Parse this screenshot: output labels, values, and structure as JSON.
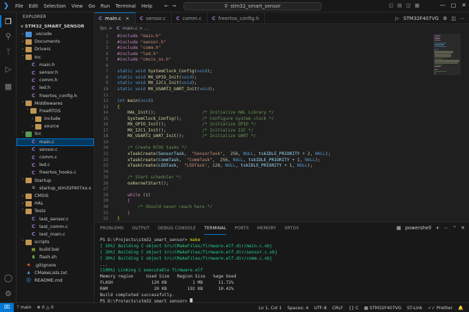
{
  "titlebar": {
    "menu": [
      "File",
      "Edit",
      "Selection",
      "View",
      "Go",
      "Run",
      "Terminal",
      "Help"
    ],
    "search": "stm32_smart_sensor"
  },
  "sidebar": {
    "header": "EXPLORER",
    "root": "STM32_SMART_SENSOR",
    "tree": [
      {
        "label": ".vscode",
        "type": "folder-blue",
        "depth": 1,
        "chev": ">"
      },
      {
        "label": "Documents",
        "type": "folder",
        "depth": 1,
        "chev": ">"
      },
      {
        "label": "Drivers",
        "type": "folder",
        "depth": 1,
        "chev": ">"
      },
      {
        "label": "Inc",
        "type": "folder",
        "depth": 1,
        "chev": "v"
      },
      {
        "label": "main.h",
        "type": "h",
        "depth": 2
      },
      {
        "label": "sensor.h",
        "type": "h",
        "depth": 2
      },
      {
        "label": "comm.h",
        "type": "h",
        "depth": 2
      },
      {
        "label": "led.h",
        "type": "h",
        "depth": 2
      },
      {
        "label": "freertos_config.h",
        "type": "h",
        "depth": 2
      },
      {
        "label": "Middlewares",
        "type": "folder",
        "depth": 1,
        "chev": "v"
      },
      {
        "label": "FreeRTOS",
        "type": "folder",
        "depth": 2,
        "chev": "v"
      },
      {
        "label": "include",
        "type": "folder",
        "depth": 3,
        "chev": ">"
      },
      {
        "label": "source",
        "type": "folder",
        "depth": 3,
        "chev": ">"
      },
      {
        "label": "Src",
        "type": "folder-green",
        "depth": 1,
        "chev": "v"
      },
      {
        "label": "main.c",
        "type": "c",
        "depth": 2,
        "selected": true
      },
      {
        "label": "sensor.c",
        "type": "c",
        "depth": 2
      },
      {
        "label": "comm.c",
        "type": "c",
        "depth": 2
      },
      {
        "label": "led.c",
        "type": "c",
        "depth": 2
      },
      {
        "label": "freertos_hooks.c",
        "type": "c",
        "depth": 2
      },
      {
        "label": "Startup",
        "type": "folder",
        "depth": 1,
        "chev": "v"
      },
      {
        "label": "startup_stm32f407xx.s",
        "type": "s",
        "depth": 2
      },
      {
        "label": "CMSIS",
        "type": "folder",
        "depth": 1,
        "chev": ">"
      },
      {
        "label": "HAL",
        "type": "folder",
        "depth": 1,
        "chev": ">"
      },
      {
        "label": "Tests",
        "type": "folder",
        "depth": 1,
        "chev": "v"
      },
      {
        "label": "test_sensor.c",
        "type": "c",
        "depth": 2
      },
      {
        "label": "test_comm.c",
        "type": "c",
        "depth": 2
      },
      {
        "label": "test_main.c",
        "type": "c",
        "depth": 2
      },
      {
        "label": "scripts",
        "type": "folder",
        "depth": 1,
        "chev": "v"
      },
      {
        "label": "build.bat",
        "type": "bat",
        "depth": 2
      },
      {
        "label": "flash.sh",
        "type": "sh",
        "depth": 2
      },
      {
        "label": ".gitignore",
        "type": "git",
        "depth": 1
      },
      {
        "label": "CMakeLists.txt",
        "type": "cmake",
        "depth": 1
      },
      {
        "label": "README.md",
        "type": "md",
        "depth": 1
      }
    ]
  },
  "tabs": [
    {
      "label": "main.c",
      "active": true
    },
    {
      "label": "sensor.c",
      "active": false
    },
    {
      "label": "comm.c",
      "active": false
    },
    {
      "label": "freertos_config.h",
      "active": false
    }
  ],
  "run": {
    "target": "STM32F407VG"
  },
  "breadcrumb": {
    "folder": "Src",
    "sep": ">",
    "file": "main.c",
    "tail": "..."
  },
  "code": [
    {
      "n": "1",
      "tokens": [
        [
          "#include ",
          "pp"
        ],
        [
          "\"main.h\"",
          "str"
        ]
      ]
    },
    {
      "n": "2",
      "tokens": [
        [
          "#include ",
          "pp"
        ],
        [
          "\"sensor.h\"",
          "str"
        ]
      ]
    },
    {
      "n": "3",
      "tokens": [
        [
          "#include ",
          "pp"
        ],
        [
          "\"comm.h\"",
          "str"
        ]
      ]
    },
    {
      "n": "4",
      "tokens": [
        [
          "#include ",
          "pp"
        ],
        [
          "\"led.h\"",
          "str"
        ]
      ]
    },
    {
      "n": "5",
      "tokens": [
        [
          "#include ",
          "pp"
        ],
        [
          "\"cmsis_os.h\"",
          "str"
        ]
      ]
    },
    {
      "n": "6",
      "tokens": []
    },
    {
      "n": "7",
      "tokens": [
        [
          "static ",
          "kw"
        ],
        [
          "void ",
          "kw"
        ],
        [
          "SystemClock_Config",
          "fn"
        ],
        [
          "(",
          "p"
        ],
        [
          "void",
          "kw"
        ],
        [
          ");",
          "p"
        ]
      ]
    },
    {
      "n": "8",
      "tokens": [
        [
          "static ",
          "kw"
        ],
        [
          "void ",
          "kw"
        ],
        [
          "MX_GPIO_Init",
          "fn"
        ],
        [
          "(",
          "p"
        ],
        [
          "void",
          "kw"
        ],
        [
          ");",
          "p"
        ]
      ]
    },
    {
      "n": "9",
      "tokens": [
        [
          "static ",
          "kw"
        ],
        [
          "void ",
          "kw"
        ],
        [
          "MX_I2C1_Init",
          "fn"
        ],
        [
          "(",
          "p"
        ],
        [
          "void",
          "kw"
        ],
        [
          ");",
          "p"
        ]
      ]
    },
    {
      "n": "10",
      "tokens": [
        [
          "static ",
          "kw"
        ],
        [
          "void ",
          "kw"
        ],
        [
          "MX_USART2_UART_Init",
          "fn"
        ],
        [
          "(",
          "p"
        ],
        [
          "void",
          "kw"
        ],
        [
          ");",
          "p"
        ]
      ]
    },
    {
      "n": "11",
      "tokens": []
    },
    {
      "n": "12",
      "tokens": [
        [
          "int ",
          "kw"
        ],
        [
          "main",
          "fn"
        ],
        [
          "(",
          "p"
        ],
        [
          "void",
          "kw"
        ],
        [
          ")",
          "p"
        ]
      ]
    },
    {
      "n": "13",
      "tokens": [
        [
          "{",
          "br"
        ]
      ]
    },
    {
      "n": "14",
      "tokens": [
        [
          "    HAL_Init",
          "fn"
        ],
        [
          "();                  ",
          "p"
        ],
        [
          "/* Initialize HAL Library */",
          "cm"
        ]
      ]
    },
    {
      "n": "15",
      "tokens": [
        [
          "    SystemClock_Config",
          "fn"
        ],
        [
          "();        ",
          "p"
        ],
        [
          "/* Configure system clock */",
          "cm"
        ]
      ]
    },
    {
      "n": "16",
      "tokens": [
        [
          "    MX_GPIO_Init",
          "fn"
        ],
        [
          "();              ",
          "p"
        ],
        [
          "/* Initialize GPIO */",
          "cm"
        ]
      ]
    },
    {
      "n": "17",
      "tokens": [
        [
          "    MX_I2C1_Init",
          "fn"
        ],
        [
          "();              ",
          "p"
        ],
        [
          "/* Initialize I2C */",
          "cm"
        ]
      ]
    },
    {
      "n": "18",
      "tokens": [
        [
          "    MX_USART2_UART_Init",
          "fn"
        ],
        [
          "();       ",
          "p"
        ],
        [
          "/* Initialize UART */",
          "cm"
        ]
      ]
    },
    {
      "n": "19",
      "tokens": []
    },
    {
      "n": "20",
      "tokens": [
        [
          "    /* Create RTOS tasks */",
          "cm"
        ]
      ]
    },
    {
      "n": "21",
      "tokens": [
        [
          "    xTaskCreate",
          "fn"
        ],
        [
          "(",
          "p"
        ],
        [
          "SensorTask",
          "var"
        ],
        [
          ",  ",
          "p"
        ],
        [
          "\"SensorTask\"",
          "str"
        ],
        [
          ",  ",
          "p"
        ],
        [
          "256",
          "num"
        ],
        [
          ", ",
          "p"
        ],
        [
          "NULL",
          "kw"
        ],
        [
          ", ",
          "p"
        ],
        [
          "tskIDLE_PRIORITY",
          "var"
        ],
        [
          " + ",
          "p"
        ],
        [
          "2",
          "num"
        ],
        [
          ", ",
          "p"
        ],
        [
          "NULL",
          "kw"
        ],
        [
          ");",
          "p"
        ]
      ]
    },
    {
      "n": "22",
      "tokens": [
        [
          "    xTaskCreate",
          "fn"
        ],
        [
          "(",
          "p"
        ],
        [
          "CommTask",
          "var"
        ],
        [
          ",  ",
          "p"
        ],
        [
          "\"CommTask\"",
          "str"
        ],
        [
          ",  ",
          "p"
        ],
        [
          "256",
          "num"
        ],
        [
          ", ",
          "p"
        ],
        [
          "NULL",
          "kw"
        ],
        [
          ", ",
          "p"
        ],
        [
          "tskIDLE_PRIORITY",
          "var"
        ],
        [
          " + ",
          "p"
        ],
        [
          "1",
          "num"
        ],
        [
          ", ",
          "p"
        ],
        [
          "NULL",
          "kw"
        ],
        [
          ");",
          "p"
        ]
      ]
    },
    {
      "n": "23",
      "tokens": [
        [
          "    xTaskCreate",
          "fn"
        ],
        [
          "(",
          "p"
        ],
        [
          "LEDTask",
          "var"
        ],
        [
          ",  ",
          "p"
        ],
        [
          "\"LEDTask\"",
          "str"
        ],
        [
          ", ",
          "p"
        ],
        [
          "128",
          "num"
        ],
        [
          ", ",
          "p"
        ],
        [
          "NULL",
          "kw"
        ],
        [
          ", ",
          "p"
        ],
        [
          "tskIDLE_PRIORITY",
          "var"
        ],
        [
          " + ",
          "p"
        ],
        [
          "1",
          "num"
        ],
        [
          ", ",
          "p"
        ],
        [
          "NULL",
          "kw"
        ],
        [
          ");",
          "p"
        ]
      ]
    },
    {
      "n": "24",
      "tokens": []
    },
    {
      "n": "25",
      "tokens": [
        [
          "    /* Start scheduler */",
          "cm"
        ]
      ]
    },
    {
      "n": "26",
      "tokens": [
        [
          "    osKernelStart",
          "fn"
        ],
        [
          "();",
          "p"
        ]
      ]
    },
    {
      "n": "27",
      "tokens": []
    },
    {
      "n": "28",
      "tokens": [
        [
          "    while ",
          "kw2"
        ],
        [
          "(",
          "p"
        ],
        [
          "1",
          "num"
        ],
        [
          ")",
          "p"
        ]
      ]
    },
    {
      "n": "29",
      "tokens": [
        [
          "    {",
          "br2"
        ]
      ]
    },
    {
      "n": "30",
      "tokens": [
        [
          "        /* Should never reach here */",
          "cm"
        ]
      ]
    },
    {
      "n": "31",
      "tokens": [
        [
          "    }",
          "br2"
        ]
      ]
    },
    {
      "n": "32",
      "tokens": [
        [
          "}",
          "br"
        ]
      ]
    }
  ],
  "panel": {
    "tabs": [
      "PROBLEMS",
      "OUTPUT",
      "DEBUG CONSOLE",
      "TERMINAL",
      "PORTS",
      "MEMORY",
      "XRTOS"
    ],
    "active_tab": "TERMINAL",
    "shell": "powershell",
    "lines": [
      [
        [
          "PS D:\\Projects\\stm32_smart_sensor> ",
          "t"
        ],
        [
          "make",
          "ty"
        ]
      ],
      [
        [
          "[ 10%] Building C object Src/CMakeFiles/firmware.elf.dir/main.c.obj",
          "tg"
        ]
      ],
      [
        [
          "[ 20%] Building C object Src/CMakeFiles/firmware.elf.dir/sensor.c.obj",
          "tg"
        ]
      ],
      [
        [
          "[ 30%] Building C object Src/CMakeFiles/firmware.elf.dir/comm.c.obj",
          "tg"
        ]
      ],
      [
        [
          "...",
          "t"
        ]
      ],
      [
        [
          "[100%] Linking C executable firmware.elf",
          "tg"
        ]
      ],
      [
        [
          "Memory region     Used Size   Region Size   %age Used",
          "t"
        ]
      ],
      [
        [
          "FLASH               120 KB          1 MB      11.72%",
          "t"
        ]
      ],
      [
        [
          "RAM                  20 KB        192 KB      10.42%",
          "t"
        ]
      ],
      [
        [
          "Build completed successfully.",
          "t"
        ]
      ],
      [
        [
          "PS D:\\Projects\\stm32_smart_sensor> ",
          "t"
        ],
        [
          "█",
          "t"
        ]
      ]
    ]
  },
  "status": {
    "branch": "main",
    "errors": "0",
    "warnings": "0",
    "position": "Ln 1, Col 1",
    "spaces": "Spaces: 4",
    "encoding": "UTF-8",
    "eol": "CRLF",
    "lang": "C",
    "target": "STM32F407VG",
    "link": "ST-Link",
    "prettier": "Prettier"
  },
  "colors": {
    "kw": "#569cd6",
    "kw2": "#c586c0",
    "fn": "#dcdcaa",
    "str": "#ce9178",
    "cm": "#6a9955",
    "num": "#b5cea8",
    "pp": "#c586c0",
    "var": "#9cdcfe",
    "p": "#cccccc",
    "br": "#ffd700",
    "br2": "#da70d6",
    "t": "#cccccc",
    "ty": "#e5e510",
    "tg": "#23d18b"
  }
}
